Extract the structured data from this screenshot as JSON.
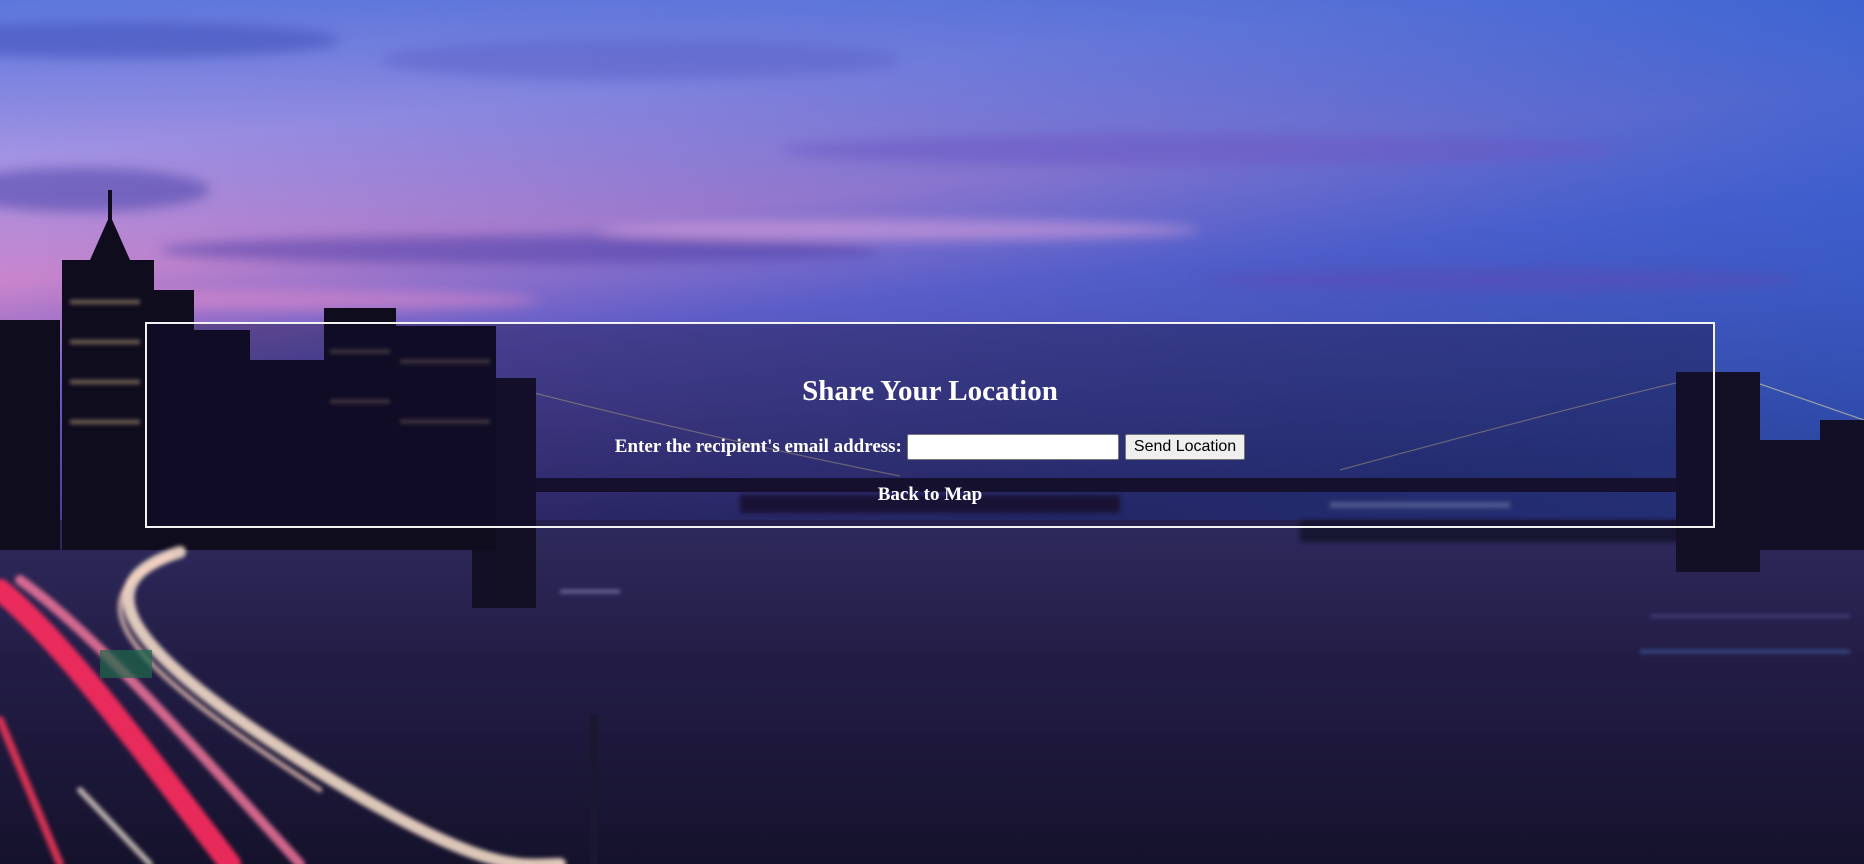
{
  "page": {
    "heading": "Share Your Location"
  },
  "form": {
    "email_label": "Enter the recipient's email address:",
    "email_value": "",
    "email_placeholder": "",
    "send_label": "Send Location"
  },
  "nav": {
    "back_label": "Back to Map"
  },
  "colors": {
    "panel_border": "#f2f2f2",
    "text": "#ffffff",
    "sky_top": "#5a6fd6",
    "sky_pink": "#d77fc4",
    "water": "#231d46"
  }
}
